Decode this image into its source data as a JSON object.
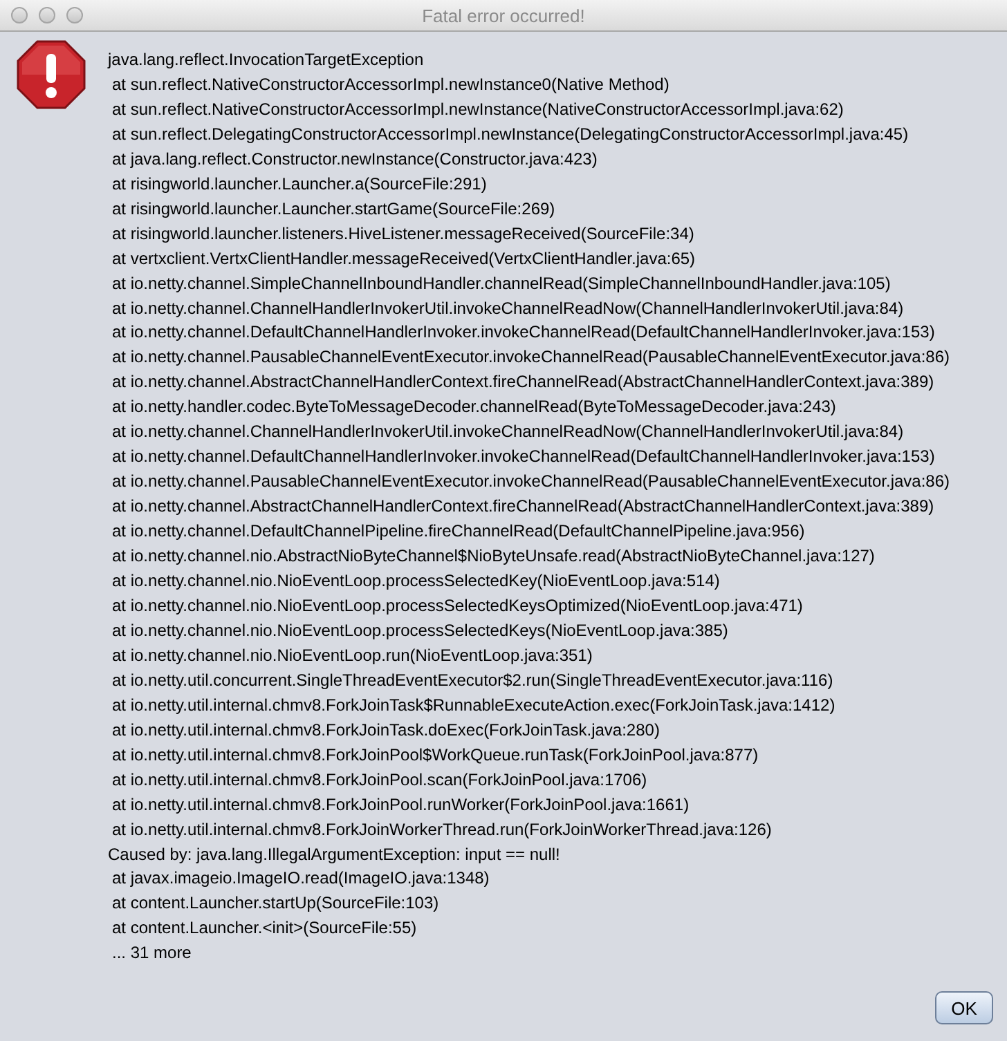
{
  "window": {
    "title": "Fatal error occurred!"
  },
  "message_lines": [
    {
      "kind": "exception",
      "text": "java.lang.reflect.InvocationTargetException"
    },
    {
      "kind": "frame",
      "text": "at sun.reflect.NativeConstructorAccessorImpl.newInstance0(Native Method)"
    },
    {
      "kind": "frame",
      "text": "at sun.reflect.NativeConstructorAccessorImpl.newInstance(NativeConstructorAccessorImpl.java:62)"
    },
    {
      "kind": "frame",
      "text": "at sun.reflect.DelegatingConstructorAccessorImpl.newInstance(DelegatingConstructorAccessorImpl.java:45)"
    },
    {
      "kind": "frame",
      "text": "at java.lang.reflect.Constructor.newInstance(Constructor.java:423)"
    },
    {
      "kind": "frame",
      "text": "at risingworld.launcher.Launcher.a(SourceFile:291)"
    },
    {
      "kind": "frame",
      "text": "at risingworld.launcher.Launcher.startGame(SourceFile:269)"
    },
    {
      "kind": "frame",
      "text": "at risingworld.launcher.listeners.HiveListener.messageReceived(SourceFile:34)"
    },
    {
      "kind": "frame",
      "text": "at vertxclient.VertxClientHandler.messageReceived(VertxClientHandler.java:65)"
    },
    {
      "kind": "frame",
      "text": "at io.netty.channel.SimpleChannelInboundHandler.channelRead(SimpleChannelInboundHandler.java:105)"
    },
    {
      "kind": "frame",
      "text": "at io.netty.channel.ChannelHandlerInvokerUtil.invokeChannelReadNow(ChannelHandlerInvokerUtil.java:84)"
    },
    {
      "kind": "frame",
      "text": "at io.netty.channel.DefaultChannelHandlerInvoker.invokeChannelRead(DefaultChannelHandlerInvoker.java:153)"
    },
    {
      "kind": "frame",
      "text": "at io.netty.channel.PausableChannelEventExecutor.invokeChannelRead(PausableChannelEventExecutor.java:86)"
    },
    {
      "kind": "frame",
      "text": "at io.netty.channel.AbstractChannelHandlerContext.fireChannelRead(AbstractChannelHandlerContext.java:389)"
    },
    {
      "kind": "frame",
      "text": "at io.netty.handler.codec.ByteToMessageDecoder.channelRead(ByteToMessageDecoder.java:243)"
    },
    {
      "kind": "frame",
      "text": "at io.netty.channel.ChannelHandlerInvokerUtil.invokeChannelReadNow(ChannelHandlerInvokerUtil.java:84)"
    },
    {
      "kind": "frame",
      "text": "at io.netty.channel.DefaultChannelHandlerInvoker.invokeChannelRead(DefaultChannelHandlerInvoker.java:153)"
    },
    {
      "kind": "frame",
      "text": "at io.netty.channel.PausableChannelEventExecutor.invokeChannelRead(PausableChannelEventExecutor.java:86)"
    },
    {
      "kind": "frame",
      "text": "at io.netty.channel.AbstractChannelHandlerContext.fireChannelRead(AbstractChannelHandlerContext.java:389)"
    },
    {
      "kind": "frame",
      "text": "at io.netty.channel.DefaultChannelPipeline.fireChannelRead(DefaultChannelPipeline.java:956)"
    },
    {
      "kind": "frame",
      "text": "at io.netty.channel.nio.AbstractNioByteChannel$NioByteUnsafe.read(AbstractNioByteChannel.java:127)"
    },
    {
      "kind": "frame",
      "text": "at io.netty.channel.nio.NioEventLoop.processSelectedKey(NioEventLoop.java:514)"
    },
    {
      "kind": "frame",
      "text": "at io.netty.channel.nio.NioEventLoop.processSelectedKeysOptimized(NioEventLoop.java:471)"
    },
    {
      "kind": "frame",
      "text": "at io.netty.channel.nio.NioEventLoop.processSelectedKeys(NioEventLoop.java:385)"
    },
    {
      "kind": "frame",
      "text": "at io.netty.channel.nio.NioEventLoop.run(NioEventLoop.java:351)"
    },
    {
      "kind": "frame",
      "text": "at io.netty.util.concurrent.SingleThreadEventExecutor$2.run(SingleThreadEventExecutor.java:116)"
    },
    {
      "kind": "frame",
      "text": "at io.netty.util.internal.chmv8.ForkJoinTask$RunnableExecuteAction.exec(ForkJoinTask.java:1412)"
    },
    {
      "kind": "frame",
      "text": "at io.netty.util.internal.chmv8.ForkJoinTask.doExec(ForkJoinTask.java:280)"
    },
    {
      "kind": "frame",
      "text": "at io.netty.util.internal.chmv8.ForkJoinPool$WorkQueue.runTask(ForkJoinPool.java:877)"
    },
    {
      "kind": "frame",
      "text": "at io.netty.util.internal.chmv8.ForkJoinPool.scan(ForkJoinPool.java:1706)"
    },
    {
      "kind": "frame",
      "text": "at io.netty.util.internal.chmv8.ForkJoinPool.runWorker(ForkJoinPool.java:1661)"
    },
    {
      "kind": "frame",
      "text": "at io.netty.util.internal.chmv8.ForkJoinWorkerThread.run(ForkJoinWorkerThread.java:126)"
    },
    {
      "kind": "exception",
      "text": "Caused by: java.lang.IllegalArgumentException: input == null!"
    },
    {
      "kind": "frame",
      "text": "at javax.imageio.ImageIO.read(ImageIO.java:1348)"
    },
    {
      "kind": "frame",
      "text": "at content.Launcher.startUp(SourceFile:103)"
    },
    {
      "kind": "frame",
      "text": "at content.Launcher.<init>(SourceFile:55)"
    },
    {
      "kind": "frame",
      "text": "... 31 more"
    }
  ],
  "buttons": [
    {
      "label": "OK"
    }
  ]
}
